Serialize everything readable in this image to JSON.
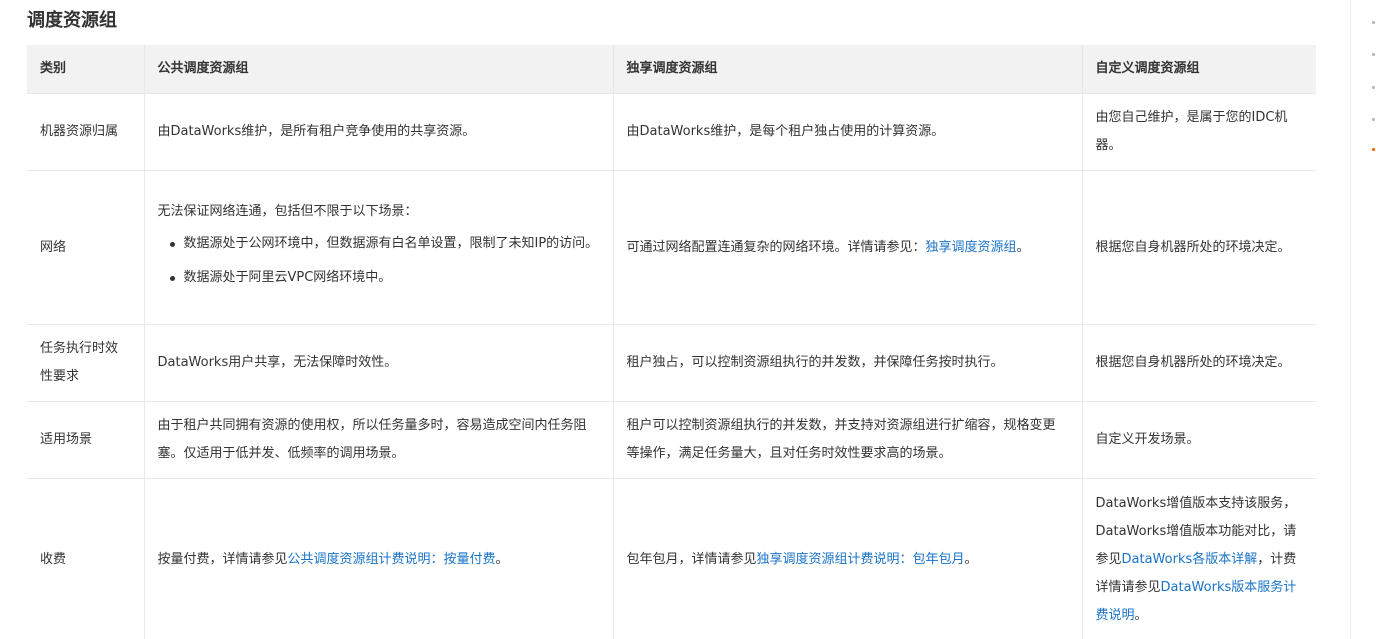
{
  "section": {
    "title": "调度资源组"
  },
  "table": {
    "headers": [
      "类别",
      "公共调度资源组",
      "独享调度资源组",
      "自定义调度资源组"
    ],
    "rows": [
      {
        "category": "机器资源归属",
        "public": "由DataWorks维护，是所有租户竞争使用的共享资源。",
        "exclusive": "由DataWorks维护，是每个租户独占使用的计算资源。",
        "custom": "由您自己维护，是属于您的IDC机器。"
      },
      {
        "category": "网络",
        "public_intro": "无法保证网络连通，包括但不限于以下场景：",
        "public_bullets": [
          "数据源处于公网环境中，但数据源有白名单设置，限制了未知IP的访问。",
          "数据源处于阿里云VPC网络环境中。"
        ],
        "exclusive_prefix": "可通过网络配置连通复杂的网络环境。详情请参见：",
        "exclusive_link": "独享调度资源组",
        "exclusive_suffix": "。",
        "custom": "根据您自身机器所处的环境决定。"
      },
      {
        "category": "任务执行时效性要求",
        "public": "DataWorks用户共享，无法保障时效性。",
        "exclusive": "租户独占，可以控制资源组执行的并发数，并保障任务按时执行。",
        "custom": "根据您自身机器所处的环境决定。"
      },
      {
        "category": "适用场景",
        "public": "由于租户共同拥有资源的使用权，所以任务量多时，容易造成空间内任务阻塞。仅适用于低并发、低频率的调用场景。",
        "exclusive": "租户可以控制资源组执行的并发数，并支持对资源组进行扩缩容，规格变更等操作，满足任务量大，且对任务时效性要求高的场景。",
        "custom": "自定义开发场景。"
      },
      {
        "category": "收费",
        "public_prefix": "按量付费，详情请参见",
        "public_link": "公共调度资源组计费说明：按量付费",
        "public_suffix": "。",
        "exclusive_prefix": "包年包月，详情请参见",
        "exclusive_link": "独享调度资源组计费说明：包年包月",
        "exclusive_suffix": "。",
        "custom_text1": "DataWorks增值版本支持该服务，DataWorks增值版本功能对比，请参见",
        "custom_link1": "DataWorks各版本详解",
        "custom_text2": "，计费详情请参见",
        "custom_link2": "DataWorks版本服务计费说明",
        "custom_text3": "。"
      }
    ]
  },
  "colors": {
    "link": "#1a73c8",
    "header_bg": "#f2f2f2",
    "border": "#e8e8e8",
    "rail_active": "#ff6a00"
  }
}
